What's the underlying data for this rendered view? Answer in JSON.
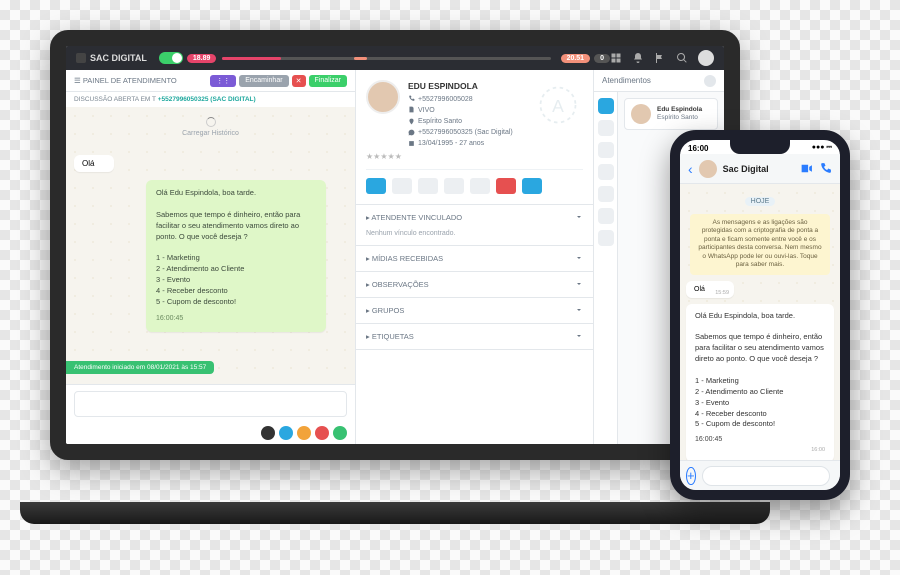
{
  "brand": "SAC DIGITAL",
  "topbar": {
    "pill1": "18.89",
    "pill2": "20.51",
    "pill3": "0"
  },
  "panel": {
    "title": "PAINEL DE ATENDIMENTO",
    "btn_group": "⋮⋮",
    "btn_encaminhar": "Encaminhar",
    "btn_close": "✕",
    "btn_finalizar": "Finalizar",
    "subhead_pre": "DISCUSSÃO ABERTA EM T",
    "subhead_link": "+5527996050325 (SAC DIGITAL)"
  },
  "chat": {
    "history": "Carregar Histórico",
    "in1": "Olá",
    "out_greeting": "Olá Edu Espindola, boa tarde.",
    "out_body": "Sabemos que tempo é dinheiro, então para facilitar o seu atendimento vamos direto ao ponto. O que você deseja ?",
    "options": [
      "1 - Marketing",
      "2 - Atendimento ao Cliente",
      "3 - Evento",
      "4 - Receber desconto",
      "5 - Cupom de desconto!"
    ],
    "out_time": "16:00:45",
    "session_tag": "Atendimento iniciado em 08/01/2021 às 15:57"
  },
  "profile": {
    "name": "EDU ESPINDOLA",
    "phone": "+5527996005028",
    "status": "VIVO",
    "location": "Espírito Santo",
    "channel": "+5527996050325 (Sac Digital)",
    "birth": "13/04/1995 - 27 anos"
  },
  "quick_colors": [
    "#2aa7e0",
    "#eceff2",
    "#eceff2",
    "#eceff2",
    "#eceff2",
    "#e65050",
    "#2aa7e0"
  ],
  "accordions": [
    {
      "title": "ATENDENTE VINCULADO",
      "open": true,
      "body": "Nenhum vínculo encontrado."
    },
    {
      "title": "MÍDIAS RECEBIDAS",
      "open": false
    },
    {
      "title": "OBSERVAÇÕES",
      "open": false
    },
    {
      "title": "GRUPOS",
      "open": false
    },
    {
      "title": "ETIQUETAS",
      "open": false
    }
  ],
  "right": {
    "tab": "Atendimentos",
    "rail_colors": [
      "#2aa7e0",
      "#eceff2",
      "#eceff2",
      "#eceff2",
      "#eceff2",
      "#eceff2",
      "#eceff2"
    ],
    "ticket": {
      "name": "Edu Espindola",
      "sub": "Espírito Santo"
    }
  },
  "compose_circles": [
    "#333",
    "#2aa7e0",
    "#f2a33a",
    "#e65050",
    "#38c172"
  ],
  "phone": {
    "time": "16:00",
    "contact": "Sac Digital",
    "date_pill": "HOJE",
    "encrypt": "As mensagens e as ligações são protegidas com a criptografia de ponta a ponta e ficam somente entre você e os participantes desta conversa. Nem mesmo o WhatsApp pode ler ou ouvi-las. Toque para saber mais.",
    "in1": "Olá",
    "in1_time": "15:59",
    "out_greeting": "Olá Edu Espindola, boa tarde.",
    "out_body": "Sabemos que tempo é dinheiro, então para facilitar o seu atendimento vamos direto ao ponto. O que você deseja ?",
    "out_time": "16:00:45",
    "out_stamp": "16:00"
  }
}
